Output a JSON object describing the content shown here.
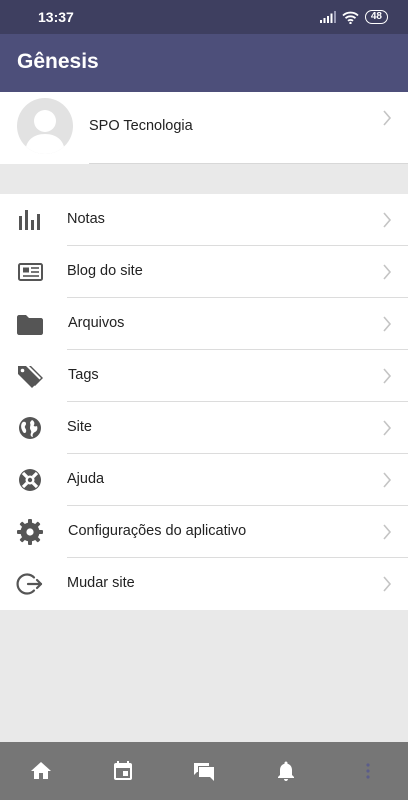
{
  "status_bar": {
    "time": "13:37",
    "battery": "48"
  },
  "app_bar": {
    "title": "Gênesis"
  },
  "profile": {
    "name": "SPO Tecnologia"
  },
  "menu": [
    {
      "label": "Notas",
      "icon": "bar-chart-icon"
    },
    {
      "label": "Blog do site",
      "icon": "newspaper-icon"
    },
    {
      "label": "Arquivos",
      "icon": "folder-icon"
    },
    {
      "label": "Tags",
      "icon": "tags-icon"
    },
    {
      "label": "Site",
      "icon": "globe-icon"
    },
    {
      "label": "Ajuda",
      "icon": "lifebuoy-icon"
    },
    {
      "label": "Configurações do aplicativo",
      "icon": "gear-icon"
    },
    {
      "label": "Mudar site",
      "icon": "sign-out-icon"
    }
  ],
  "bottom_nav": [
    "home-icon",
    "calendar-icon",
    "comments-icon",
    "bell-icon",
    "more-icon"
  ],
  "colors": {
    "status_bar": "#3e3f60",
    "app_bar": "#4d4f7a",
    "bottom_nav": "#767676",
    "active_nav": "#5b5d8a"
  }
}
